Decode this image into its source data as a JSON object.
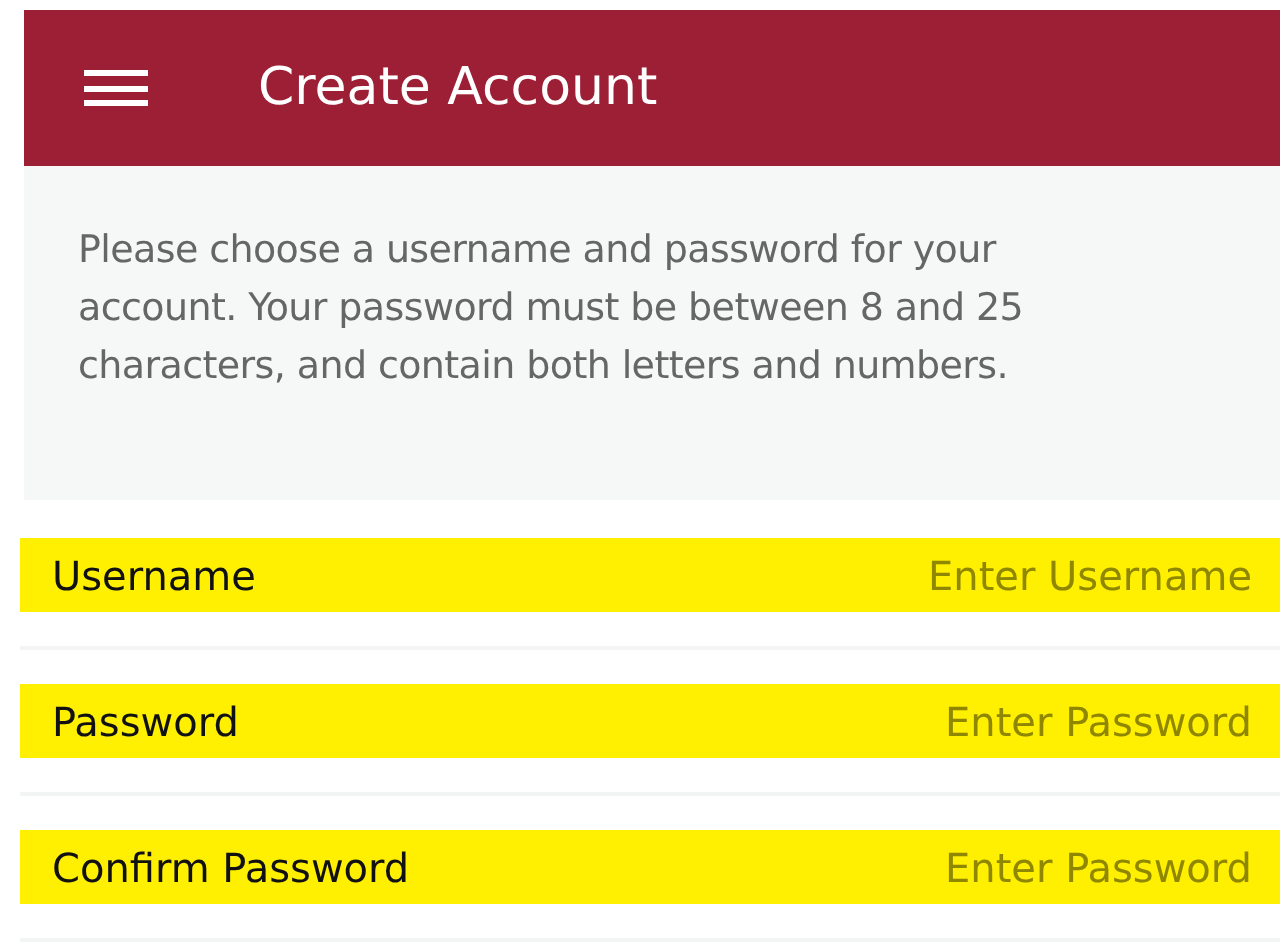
{
  "header": {
    "title": "Create Account"
  },
  "intro": "Please choose a username and password for your account. Your password must be between 8 and 25 characters, and contain both letters and numbers.",
  "fields": [
    {
      "label": "Username",
      "placeholder": "Enter Username"
    },
    {
      "label": "Password",
      "placeholder": "Enter Password"
    },
    {
      "label": "Confirm Password",
      "placeholder": "Enter Password"
    }
  ]
}
